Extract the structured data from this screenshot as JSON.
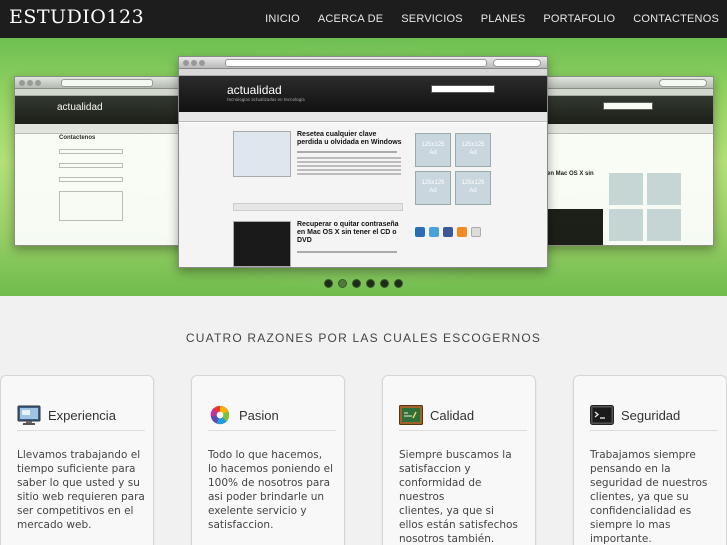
{
  "header": {
    "logo": "ESTUDIO123",
    "nav": [
      "INICIO",
      "ACERCA DE",
      "SERVICIOS",
      "PLANES",
      "PORTAFOLIO",
      "CONTACTENOS"
    ]
  },
  "slider": {
    "site_name": "actualidad",
    "site_tagline": "tecnologias actualizadas en tecnologia",
    "posts": [
      {
        "title": "Resetea cualquier clave perdida u olvidada en Windows"
      },
      {
        "title": "Recuperar o quitar contraseña en Mac OS X sin tener el CD o DVD"
      }
    ],
    "ads": [
      "125x125\nAd",
      "125x125\nAd",
      "125x125\nAd",
      "125x125\nAd"
    ],
    "left_page_title": "Contactenos",
    "right_post_title": "en Mac OS X sin",
    "dot_count": 6,
    "active_dot": 1
  },
  "section": {
    "title": "CUATRO RAZONES POR LAS CUALES ESCOGERNOS"
  },
  "cards": [
    {
      "icon": "monitor-icon",
      "title": "Experiencia",
      "text": "Llevamos trabajando el\ntiempo suficiente para\nsaber lo que usted y su\nsitio web requieren para\nser competitivos en el\nmercado web."
    },
    {
      "icon": "color-wheel-icon",
      "title": "Pasion",
      "text": "Todo lo que hacemos,\nlo hacemos poniendo el\n100% de nosotros para\nasi poder brindarle un\nexelente servicio y\nsatisfaccion."
    },
    {
      "icon": "chalkboard-icon",
      "title": "Calidad",
      "text": "Siempre buscamos la\nsatisfaccion y\nconformidad de nuestros\nclientes, ya que si\nellos están satisfechos\nnosotros también."
    },
    {
      "icon": "terminal-icon",
      "title": "Seguridad",
      "text": "Trabajamos siempre\npensando en la\nseguridad de nuestros\nclientes, ya que su\nconfidencialidad es\nsiempre lo mas\nimportante."
    }
  ]
}
